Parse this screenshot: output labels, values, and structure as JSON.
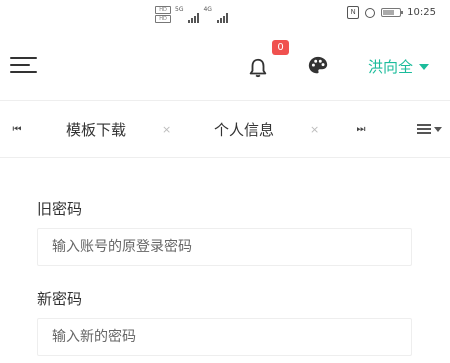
{
  "status_bar": {
    "time": "10:25",
    "nfc_label": "N",
    "sim1_label": "HD",
    "sim2_label": "HD",
    "net1_label": "5G",
    "net2_label": "4G"
  },
  "header": {
    "notification_count": "0",
    "user_name": "洪向全"
  },
  "tabs": [
    {
      "label": "模板下载",
      "close": "×"
    },
    {
      "label": "个人信息",
      "close": "×"
    }
  ],
  "tab_nav": {
    "prev": "⏮",
    "next": "⏭"
  },
  "form": {
    "old_password": {
      "label": "旧密码",
      "placeholder": "输入账号的原登录密码",
      "value": ""
    },
    "new_password": {
      "label": "新密码",
      "placeholder": "输入新的密码",
      "value": ""
    }
  },
  "colors": {
    "accent": "#1bbc9b",
    "badge": "#f0514f"
  }
}
